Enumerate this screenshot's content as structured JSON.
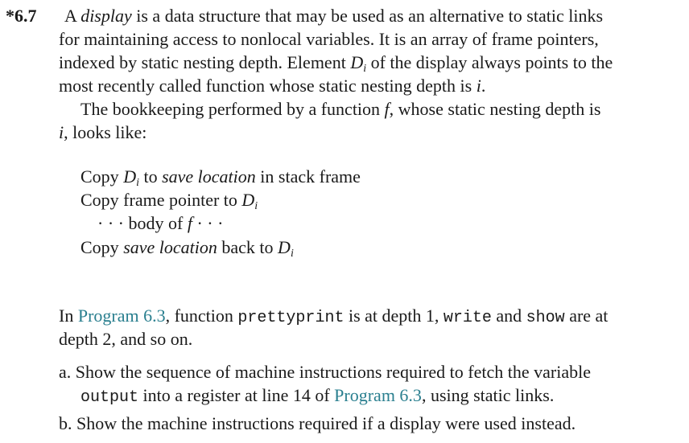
{
  "exercise": {
    "number": "*6.7",
    "p1": {
      "l1_a": "A ",
      "l1_b": "display",
      "l1_c": " is a data structure that may be used as an alternative to static links",
      "l2": "for maintaining access to nonlocal variables. It is an array of frame pointers,",
      "l3_a": "indexed by static nesting depth. Element ",
      "l3_D": "D",
      "l3_sub": "i",
      "l3_b": " of the display always points to the",
      "l4_a": "most recently called function whose static nesting depth is ",
      "l4_i": "i",
      "l4_b": "."
    },
    "p2": {
      "l1_a": "The bookkeeping performed by a function ",
      "l1_f": "f",
      "l1_b": ", whose static nesting depth is",
      "l2_i": "i",
      "l2_b": ", looks like:"
    },
    "code": {
      "c1_a": "Copy ",
      "c1_D": "D",
      "c1_sub": "i",
      "c1_b": " to ",
      "c1_c": "save location",
      "c1_d": " in stack frame",
      "c2_a": "Copy frame pointer to ",
      "c2_D": "D",
      "c2_sub": "i",
      "c3_a": "· · · body of ",
      "c3_f": "f",
      "c3_b": " · · ·",
      "c4_a": "Copy ",
      "c4_b": "save location",
      "c4_c": " back to ",
      "c4_D": "D",
      "c4_sub": "i"
    },
    "p3": {
      "l1_a": "In ",
      "l1_link": "Program 6.3",
      "l1_b": ", function ",
      "l1_code1": "prettyprint",
      "l1_c": " is at depth 1, ",
      "l1_code2": "write",
      "l1_d": " and ",
      "l1_code3": "show",
      "l1_e": " are at",
      "l2": "depth 2, and so on."
    },
    "items": {
      "a_1": "a. Show the sequence of machine instructions required to fetch the variable",
      "a_2_code": "output",
      "a_2_b": " into a register at line 14 of ",
      "a_2_link": "Program 6.3",
      "a_2_c": ", using static links.",
      "b_1": "b. Show the machine instructions required if a display were used instead."
    }
  }
}
